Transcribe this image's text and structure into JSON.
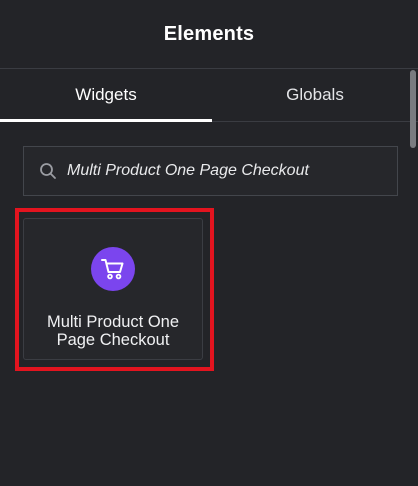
{
  "header": {
    "title": "Elements"
  },
  "tabs": [
    {
      "label": "Widgets",
      "active": true
    },
    {
      "label": "Globals",
      "active": false
    }
  ],
  "search": {
    "value": "Multi Product One Page Checkout",
    "icon": "search-icon"
  },
  "widgets": [
    {
      "label_line1": "Multi Product One",
      "label_line2": "Page Checkout",
      "icon": "cart-icon",
      "icon_color": "#7b45ee"
    }
  ],
  "colors": {
    "background": "#232428",
    "highlight": "#e3141f",
    "accent": "#7b45ee"
  }
}
